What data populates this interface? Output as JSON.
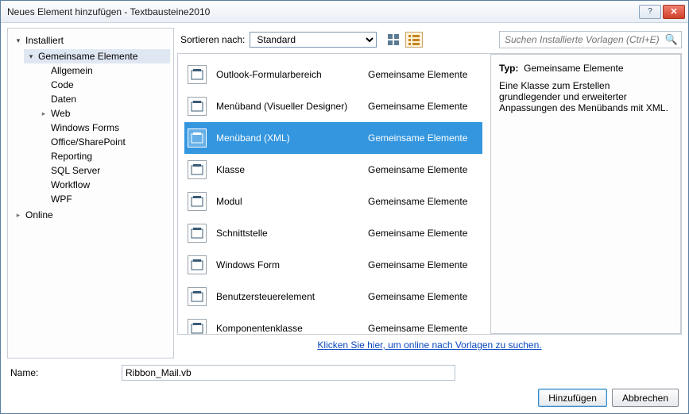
{
  "window": {
    "title": "Neues Element hinzufügen - Textbausteine2010"
  },
  "sidebar": {
    "installed_label": "Installiert",
    "shared_label": "Gemeinsame Elemente",
    "children": {
      "allgemein": "Allgemein",
      "code": "Code",
      "daten": "Daten",
      "web": "Web",
      "winforms": "Windows Forms",
      "office": "Office/SharePoint",
      "reporting": "Reporting",
      "sql": "SQL Server",
      "workflow": "Workflow",
      "wpf": "WPF"
    },
    "online_label": "Online"
  },
  "toolbar": {
    "sort_label": "Sortieren nach:",
    "sort_value": "Standard",
    "search_placeholder": "Suchen Installierte Vorlagen (Ctrl+E)"
  },
  "templates": [
    {
      "name": "Outlook-Formularbereich",
      "group": "Gemeinsame Elemente"
    },
    {
      "name": "Menüband (Visueller Designer)",
      "group": "Gemeinsame Elemente"
    },
    {
      "name": "Menüband (XML)",
      "group": "Gemeinsame Elemente",
      "selected": true
    },
    {
      "name": "Klasse",
      "group": "Gemeinsame Elemente"
    },
    {
      "name": "Modul",
      "group": "Gemeinsame Elemente"
    },
    {
      "name": "Schnittstelle",
      "group": "Gemeinsame Elemente"
    },
    {
      "name": "Windows Form",
      "group": "Gemeinsame Elemente"
    },
    {
      "name": "Benutzersteuerelement",
      "group": "Gemeinsame Elemente"
    },
    {
      "name": "Komponentenklasse",
      "group": "Gemeinsame Elemente"
    }
  ],
  "online_link": "Klicken Sie hier, um online nach Vorlagen zu suchen.",
  "details": {
    "type_label": "Typ:",
    "type_value": "Gemeinsame Elemente",
    "description": "Eine Klasse zum Erstellen grundlegender und erweiterter Anpassungen des Menübands mit XML."
  },
  "name_row": {
    "label": "Name:",
    "value": "Ribbon_Mail.vb"
  },
  "buttons": {
    "ok": "Hinzufügen",
    "cancel": "Abbrechen"
  }
}
